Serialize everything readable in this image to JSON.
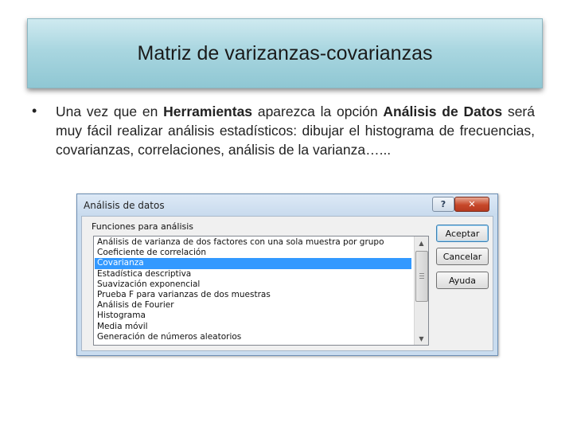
{
  "slide": {
    "title": "Matriz de varizanzas-covarianzas",
    "bullet": {
      "marker": "•",
      "text_1": "Una vez que en ",
      "bold_1": "Herramientas",
      "text_2": " aparezca la opción ",
      "bold_2": "Análisis de Datos",
      "text_3": " será muy fácil realizar análisis estadísticos: dibujar el histograma de frecuencias, covarianzas, correlaciones, análisis de la varianza…..."
    }
  },
  "dialog": {
    "title": "Análisis de datos",
    "help_label": "?",
    "close_label": "✕",
    "group_label": "Funciones para análisis",
    "items": [
      "Análisis de varianza de dos factores con una sola muestra por grupo",
      "Coeficiente de correlación",
      "Covarianza",
      "Estadística descriptiva",
      "Suavización exponencial",
      "Prueba F para varianzas de dos muestras",
      "Análisis de Fourier",
      "Histograma",
      "Media móvil",
      "Generación de números aleatorios"
    ],
    "selected_item": "Covarianza",
    "buttons": {
      "ok": "Aceptar",
      "cancel": "Cancelar",
      "help": "Ayuda"
    },
    "scroll_up_glyph": "▲",
    "scroll_down_glyph": "▼"
  }
}
